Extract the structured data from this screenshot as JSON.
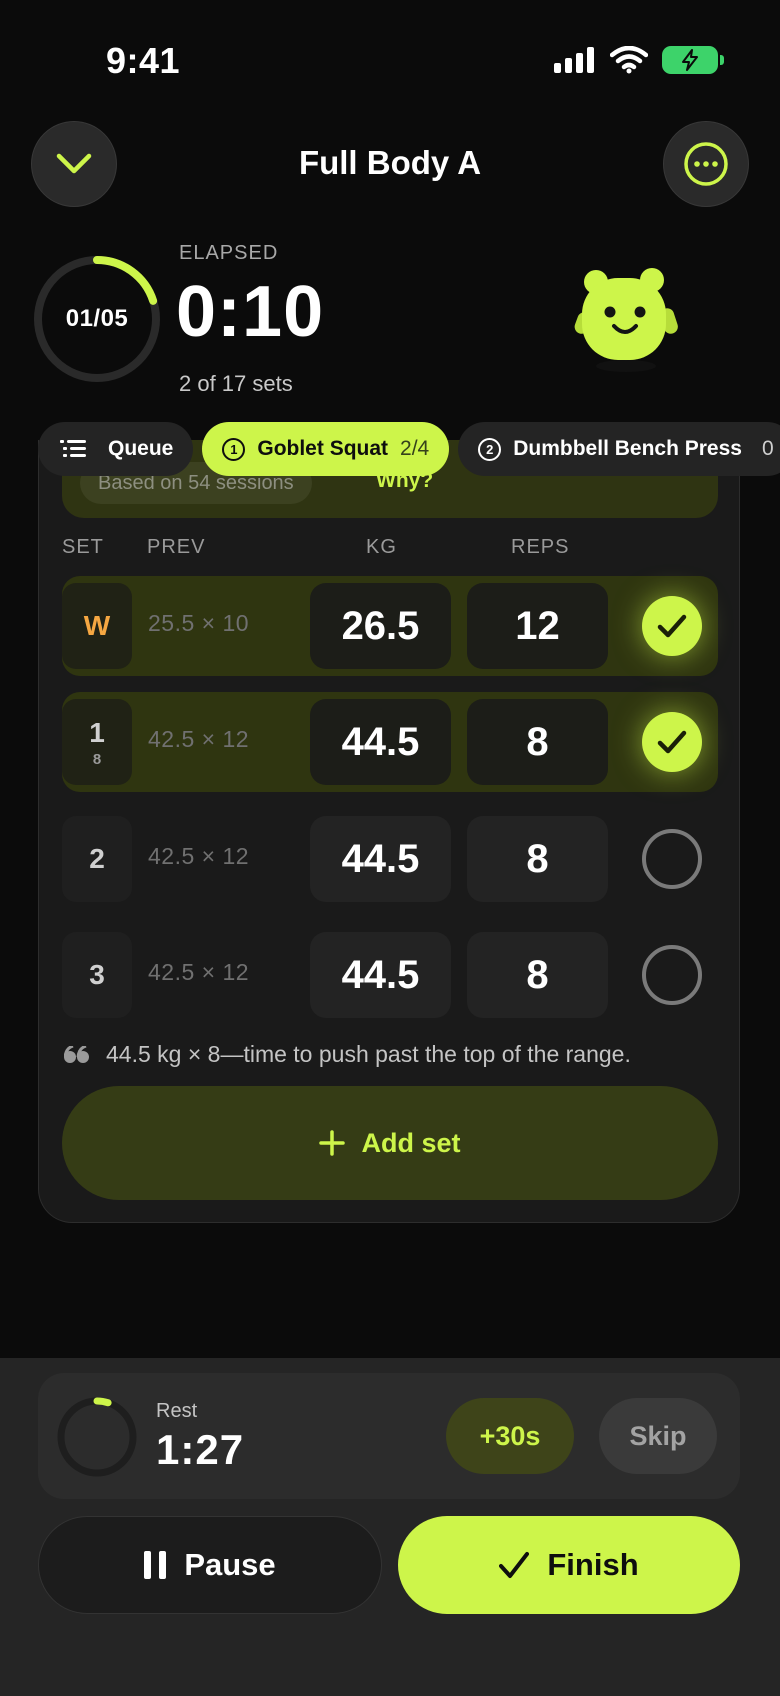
{
  "status_bar": {
    "time": "9:41"
  },
  "header": {
    "title": "Full Body A",
    "collapse_icon": "chevron-down-icon",
    "menu_icon": "more-horizontal-icon"
  },
  "progress": {
    "ring_label": "01/05",
    "ring_fraction": 0.2,
    "elapsed_label": "ELAPSED",
    "elapsed_value": "0:10",
    "sets_label": "2 of 17 sets"
  },
  "tabs": [
    {
      "label": "Queue",
      "icon": "list-icon"
    },
    {
      "number": "1",
      "label": "Goblet Squat",
      "count": "2/4",
      "active": true
    },
    {
      "number": "2",
      "label": "Dumbbell Bench Press",
      "count": "0"
    }
  ],
  "info_strip": {
    "pill": "Based on 54 sessions",
    "link": "Why?"
  },
  "columns": {
    "set": "SET",
    "prev": "PREV",
    "kg": "KG",
    "reps": "REPS"
  },
  "sets": [
    {
      "set": "W",
      "sub": "",
      "prev": "25.5 × 10",
      "kg": "26.5",
      "reps": "12",
      "done": true,
      "warmup": true
    },
    {
      "set": "1",
      "sub": "8",
      "prev": "42.5 × 12",
      "kg": "44.5",
      "reps": "8",
      "done": true
    },
    {
      "set": "2",
      "sub": "",
      "prev": "42.5 × 12",
      "kg": "44.5",
      "reps": "8",
      "done": false
    },
    {
      "set": "3",
      "sub": "",
      "prev": "42.5 × 12",
      "kg": "44.5",
      "reps": "8",
      "done": false
    }
  ],
  "tip": "44.5 kg × 8—time to push past the top of the range.",
  "add_set_label": "Add set",
  "rest": {
    "label": "Rest",
    "value": "1:27",
    "fraction": 0.05,
    "add_label": "+30s",
    "skip_label": "Skip"
  },
  "actions": {
    "pause_label": "Pause",
    "finish_label": "Finish"
  },
  "colors": {
    "accent": "#cdf54a",
    "background": "#0b0b0b",
    "warmup": "#f5a742"
  }
}
